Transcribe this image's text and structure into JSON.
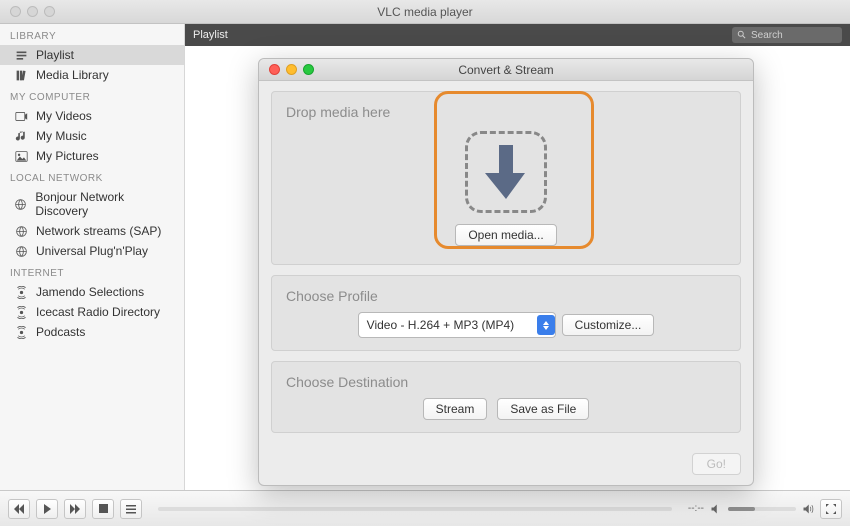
{
  "app_title": "VLC media player",
  "sidebar": {
    "sections": [
      {
        "header": "LIBRARY",
        "items": [
          {
            "icon": "list-icon",
            "label": "Playlist",
            "selected": true
          },
          {
            "icon": "library-icon",
            "label": "Media Library"
          }
        ]
      },
      {
        "header": "MY COMPUTER",
        "items": [
          {
            "icon": "video-icon",
            "label": "My Videos"
          },
          {
            "icon": "music-icon",
            "label": "My Music"
          },
          {
            "icon": "pictures-icon",
            "label": "My Pictures"
          }
        ]
      },
      {
        "header": "LOCAL NETWORK",
        "items": [
          {
            "icon": "network-icon",
            "label": "Bonjour Network Discovery"
          },
          {
            "icon": "network-icon",
            "label": "Network streams (SAP)"
          },
          {
            "icon": "network-icon",
            "label": "Universal Plug'n'Play"
          }
        ]
      },
      {
        "header": "INTERNET",
        "items": [
          {
            "icon": "podcast-icon",
            "label": "Jamendo Selections"
          },
          {
            "icon": "podcast-icon",
            "label": "Icecast Radio Directory"
          },
          {
            "icon": "podcast-icon",
            "label": "Podcasts"
          }
        ]
      }
    ]
  },
  "playlist_header": "Playlist",
  "search_placeholder": "Search",
  "modal": {
    "title": "Convert & Stream",
    "drop_title": "Drop media here",
    "open_media": "Open media...",
    "profile_title": "Choose Profile",
    "profile_selected": "Video - H.264 + MP3 (MP4)",
    "customize": "Customize...",
    "dest_title": "Choose Destination",
    "stream": "Stream",
    "save_as_file": "Save as File",
    "go": "Go!"
  },
  "bottom": {
    "time": "--:--"
  },
  "colors": {
    "highlight": "#e68a2e"
  }
}
